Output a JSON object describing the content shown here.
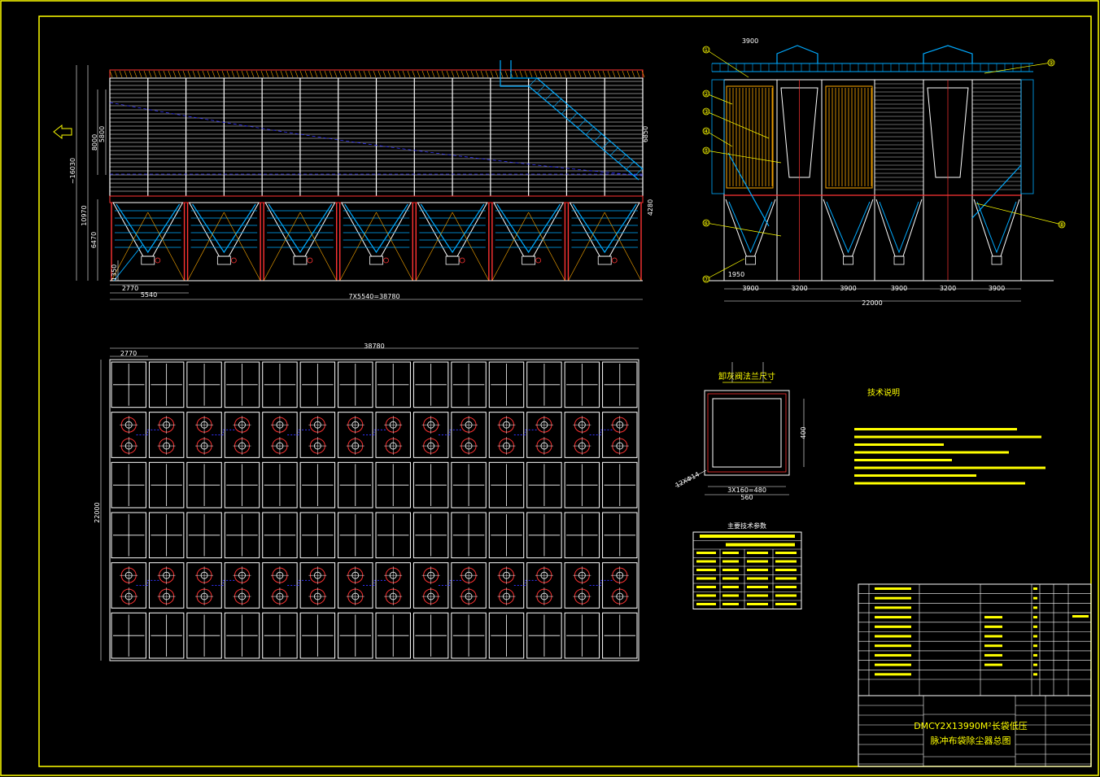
{
  "drawing": {
    "border_color": "#ffff00",
    "structure_color": "#ffffff",
    "hopper_color": "#00aaff",
    "accent_color": "#ff3333",
    "blue_dash_color": "#3333ff",
    "orange_color": "#ffaa00"
  },
  "front_view": {
    "dims_left": [
      "8000",
      "5800",
      "~16030",
      "10970",
      "6470",
      "1350"
    ],
    "dims_right": [
      "6850",
      "4280"
    ],
    "dims_bottom": [
      "2770",
      "5540",
      "7X5540=38780"
    ],
    "hopper_count": 7
  },
  "side_view": {
    "dim_top": "3900",
    "dims_bottom": [
      "3900",
      "3200",
      "3900",
      "3900",
      "3200",
      "3900"
    ],
    "dim_total": "22000",
    "dim_small": "1950",
    "callouts": [
      "①",
      "②",
      "③",
      "④",
      "⑤",
      "⑥",
      "⑦",
      "⑧",
      "⑨"
    ]
  },
  "plan_view": {
    "dim_top_total": "38780",
    "dim_top_first": "2770",
    "dim_left": "22000",
    "columns": 14,
    "rows": 6
  },
  "flange_detail": {
    "title": "卸灰阀法兰尺寸",
    "dim_right": "400",
    "dim_bottom_1": "3X160=480",
    "dim_bottom_2": "560",
    "dim_holes": "12XΦ14"
  },
  "tech_notes": {
    "title": "技术说明"
  },
  "param_table": {
    "title": "主要技术参数"
  },
  "title_block": {
    "drawing_title_1": "DMCY2X13990M²长袋低压",
    "drawing_title_2": "脉冲布袋除尘器总图"
  }
}
